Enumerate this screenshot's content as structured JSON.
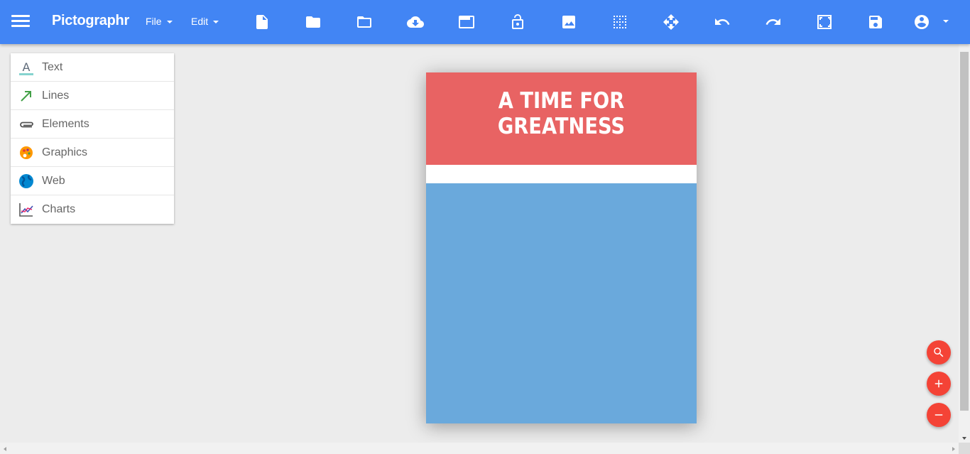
{
  "app": {
    "title": "Pictographr"
  },
  "menus": {
    "file_label": "File",
    "edit_label": "Edit"
  },
  "toolbar": {
    "tools": [
      "new-document-icon",
      "folder-icon",
      "folder-open-icon",
      "cloud-download-icon",
      "window-icon",
      "unlock-icon",
      "image-icon",
      "grid-icon",
      "move-icon",
      "undo-icon",
      "redo-icon",
      "fit-screen-icon",
      "save-icon",
      "account-icon"
    ]
  },
  "panel": {
    "items": [
      {
        "label": "Text",
        "icon": "text-icon"
      },
      {
        "label": "Lines",
        "icon": "arrow-line-icon"
      },
      {
        "label": "Elements",
        "icon": "paperclip-icon"
      },
      {
        "label": "Graphics",
        "icon": "palette-icon"
      },
      {
        "label": "Web",
        "icon": "globe-icon"
      },
      {
        "label": "Charts",
        "icon": "line-chart-icon"
      }
    ]
  },
  "canvas": {
    "headline": "A TIME FOR GREATNESS",
    "colors": {
      "top_band": "#e86363",
      "middle_band": "#ffffff",
      "bottom_band": "#6aa9dc"
    }
  },
  "fabs": [
    "zoom-search-icon",
    "zoom-in-icon",
    "zoom-out-icon"
  ],
  "theme": {
    "accent": "#4285f4",
    "fab": "#f44336"
  }
}
